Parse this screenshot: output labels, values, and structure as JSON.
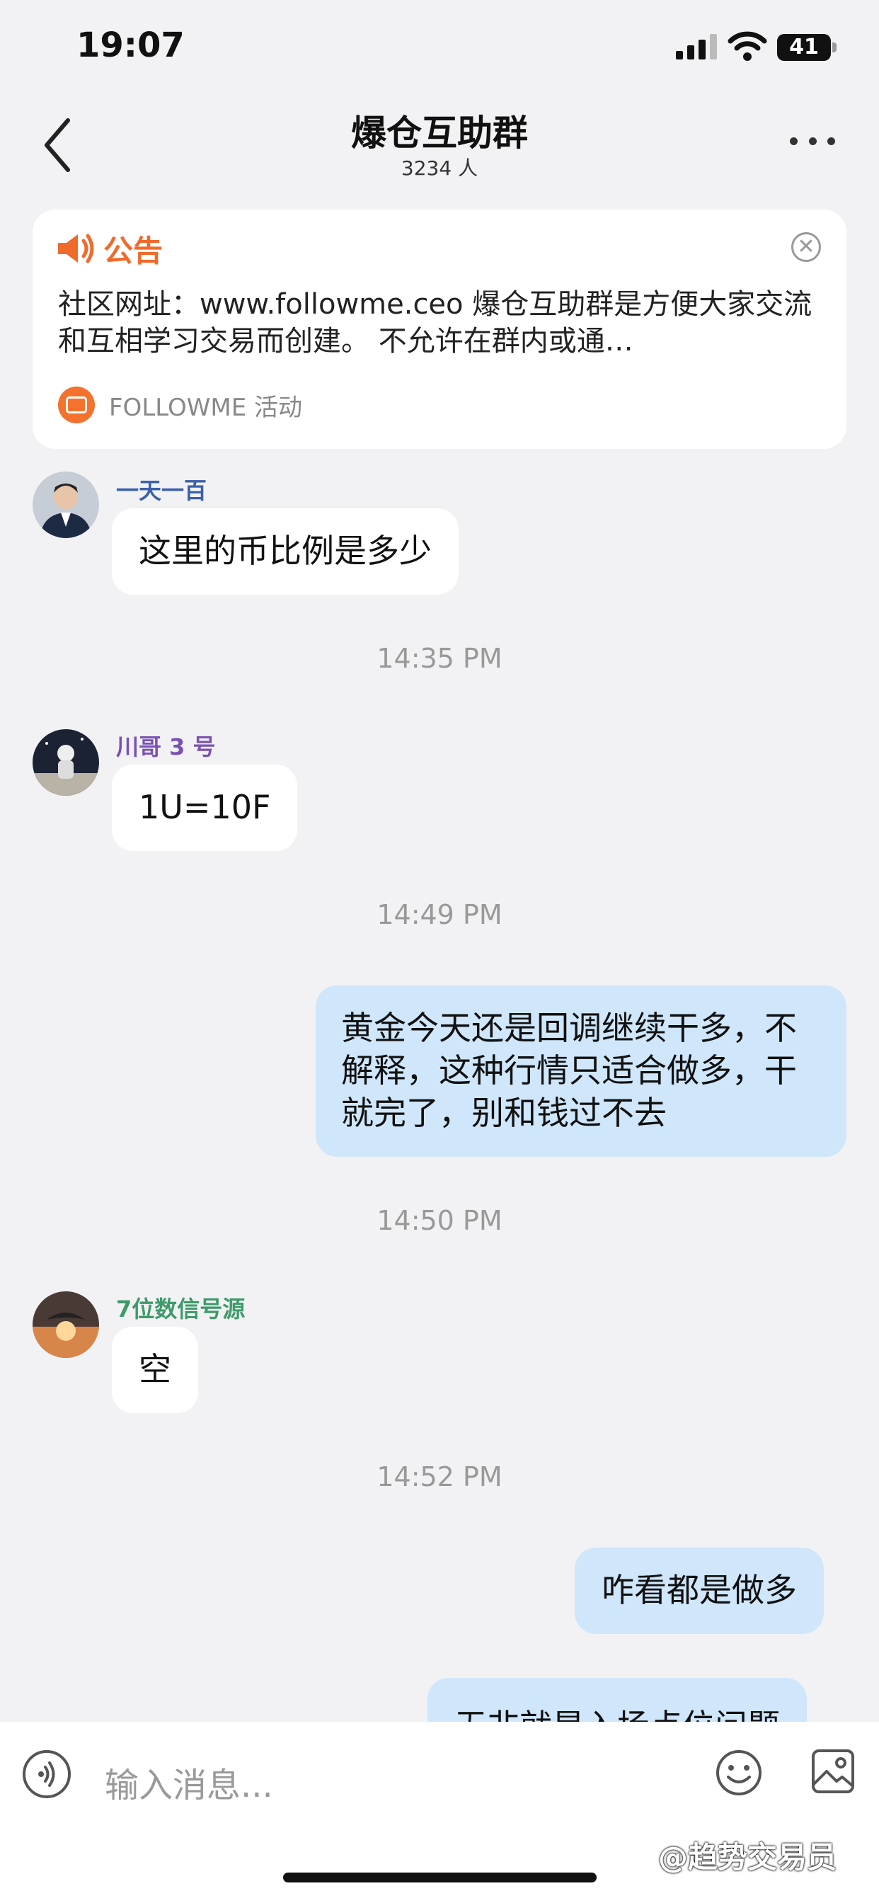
{
  "status_bar": {
    "time": "19:07",
    "battery": "41"
  },
  "header": {
    "title": "爆仓互助群",
    "member_count": "3234 人"
  },
  "notice": {
    "label": "公告",
    "text": "社区网址：www.followme.ceo 爆仓互助群是方便大家交流和互相学习交易而创建。 不允许在群内或通…",
    "source": "FOLLOWME 活动"
  },
  "messages": [
    {
      "sender": "一天一百",
      "sender_color": "#3a5fa8",
      "text": "这里的币比例是多少"
    },
    {
      "timestamp": "14:35 PM"
    },
    {
      "sender": "川哥 3 号",
      "sender_color": "#7a52b3",
      "text": "1U=10F"
    },
    {
      "timestamp": "14:49 PM"
    },
    {
      "outgoing": true,
      "text": "黄金今天还是回调继续干多，不解释，这种行情只适合做多，干就完了，别和钱过不去"
    },
    {
      "timestamp": "14:50 PM"
    },
    {
      "sender": "7位数信号源",
      "sender_color": "#3e9a6a",
      "text": "空"
    },
    {
      "timestamp": "14:52 PM"
    },
    {
      "outgoing": true,
      "text": "咋看都是做多"
    },
    {
      "outgoing": true,
      "text": "无非就是入场点位问题"
    }
  ],
  "input": {
    "placeholder": "输入消息..."
  },
  "watermark": "@趋势交易员",
  "icons": [
    "back-icon",
    "more-icon",
    "speaker-icon",
    "close-icon",
    "voice-icon",
    "emoji-icon",
    "image-icon"
  ]
}
